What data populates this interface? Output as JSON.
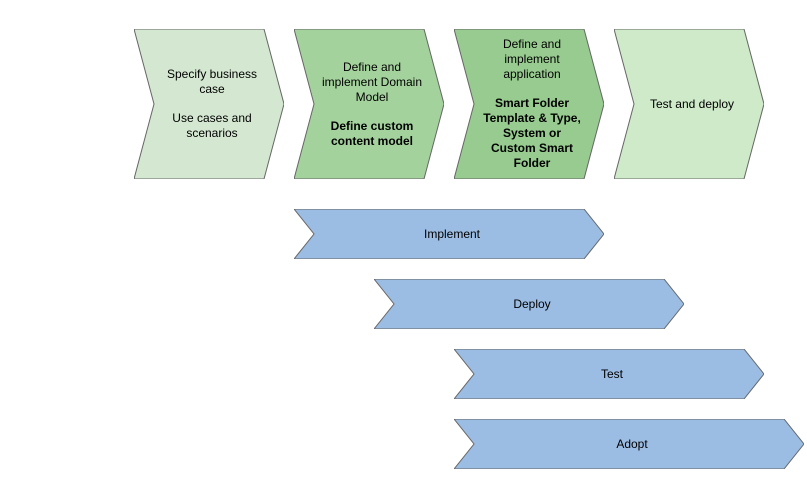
{
  "colors": {
    "step_light": "#d4e8d1",
    "step_med": "#a4d29d",
    "step_dark": "#97cb8f",
    "step_light2": "#ceeac9",
    "bar": "#9bbce3",
    "stroke": "#666666"
  },
  "steps": [
    {
      "id": "step-specify",
      "title": "Specify business case",
      "subtitle": "Use cases and scenarios",
      "subtitle_bold": false
    },
    {
      "id": "step-domain",
      "title": "Define and implement Domain Model",
      "subtitle": "Define custom content model",
      "subtitle_bold": true
    },
    {
      "id": "step-app",
      "title": "Define and implement application",
      "subtitle": "Smart Folder Template & Type, System or Custom Smart Folder",
      "subtitle_bold": true
    },
    {
      "id": "step-test",
      "title": "Test and deploy",
      "subtitle": "",
      "subtitle_bold": false
    }
  ],
  "bars": [
    {
      "id": "bar-implement",
      "label": "Implement"
    },
    {
      "id": "bar-deploy",
      "label": "Deploy"
    },
    {
      "id": "bar-test",
      "label": "Test"
    },
    {
      "id": "bar-adopt",
      "label": "Adopt"
    }
  ]
}
